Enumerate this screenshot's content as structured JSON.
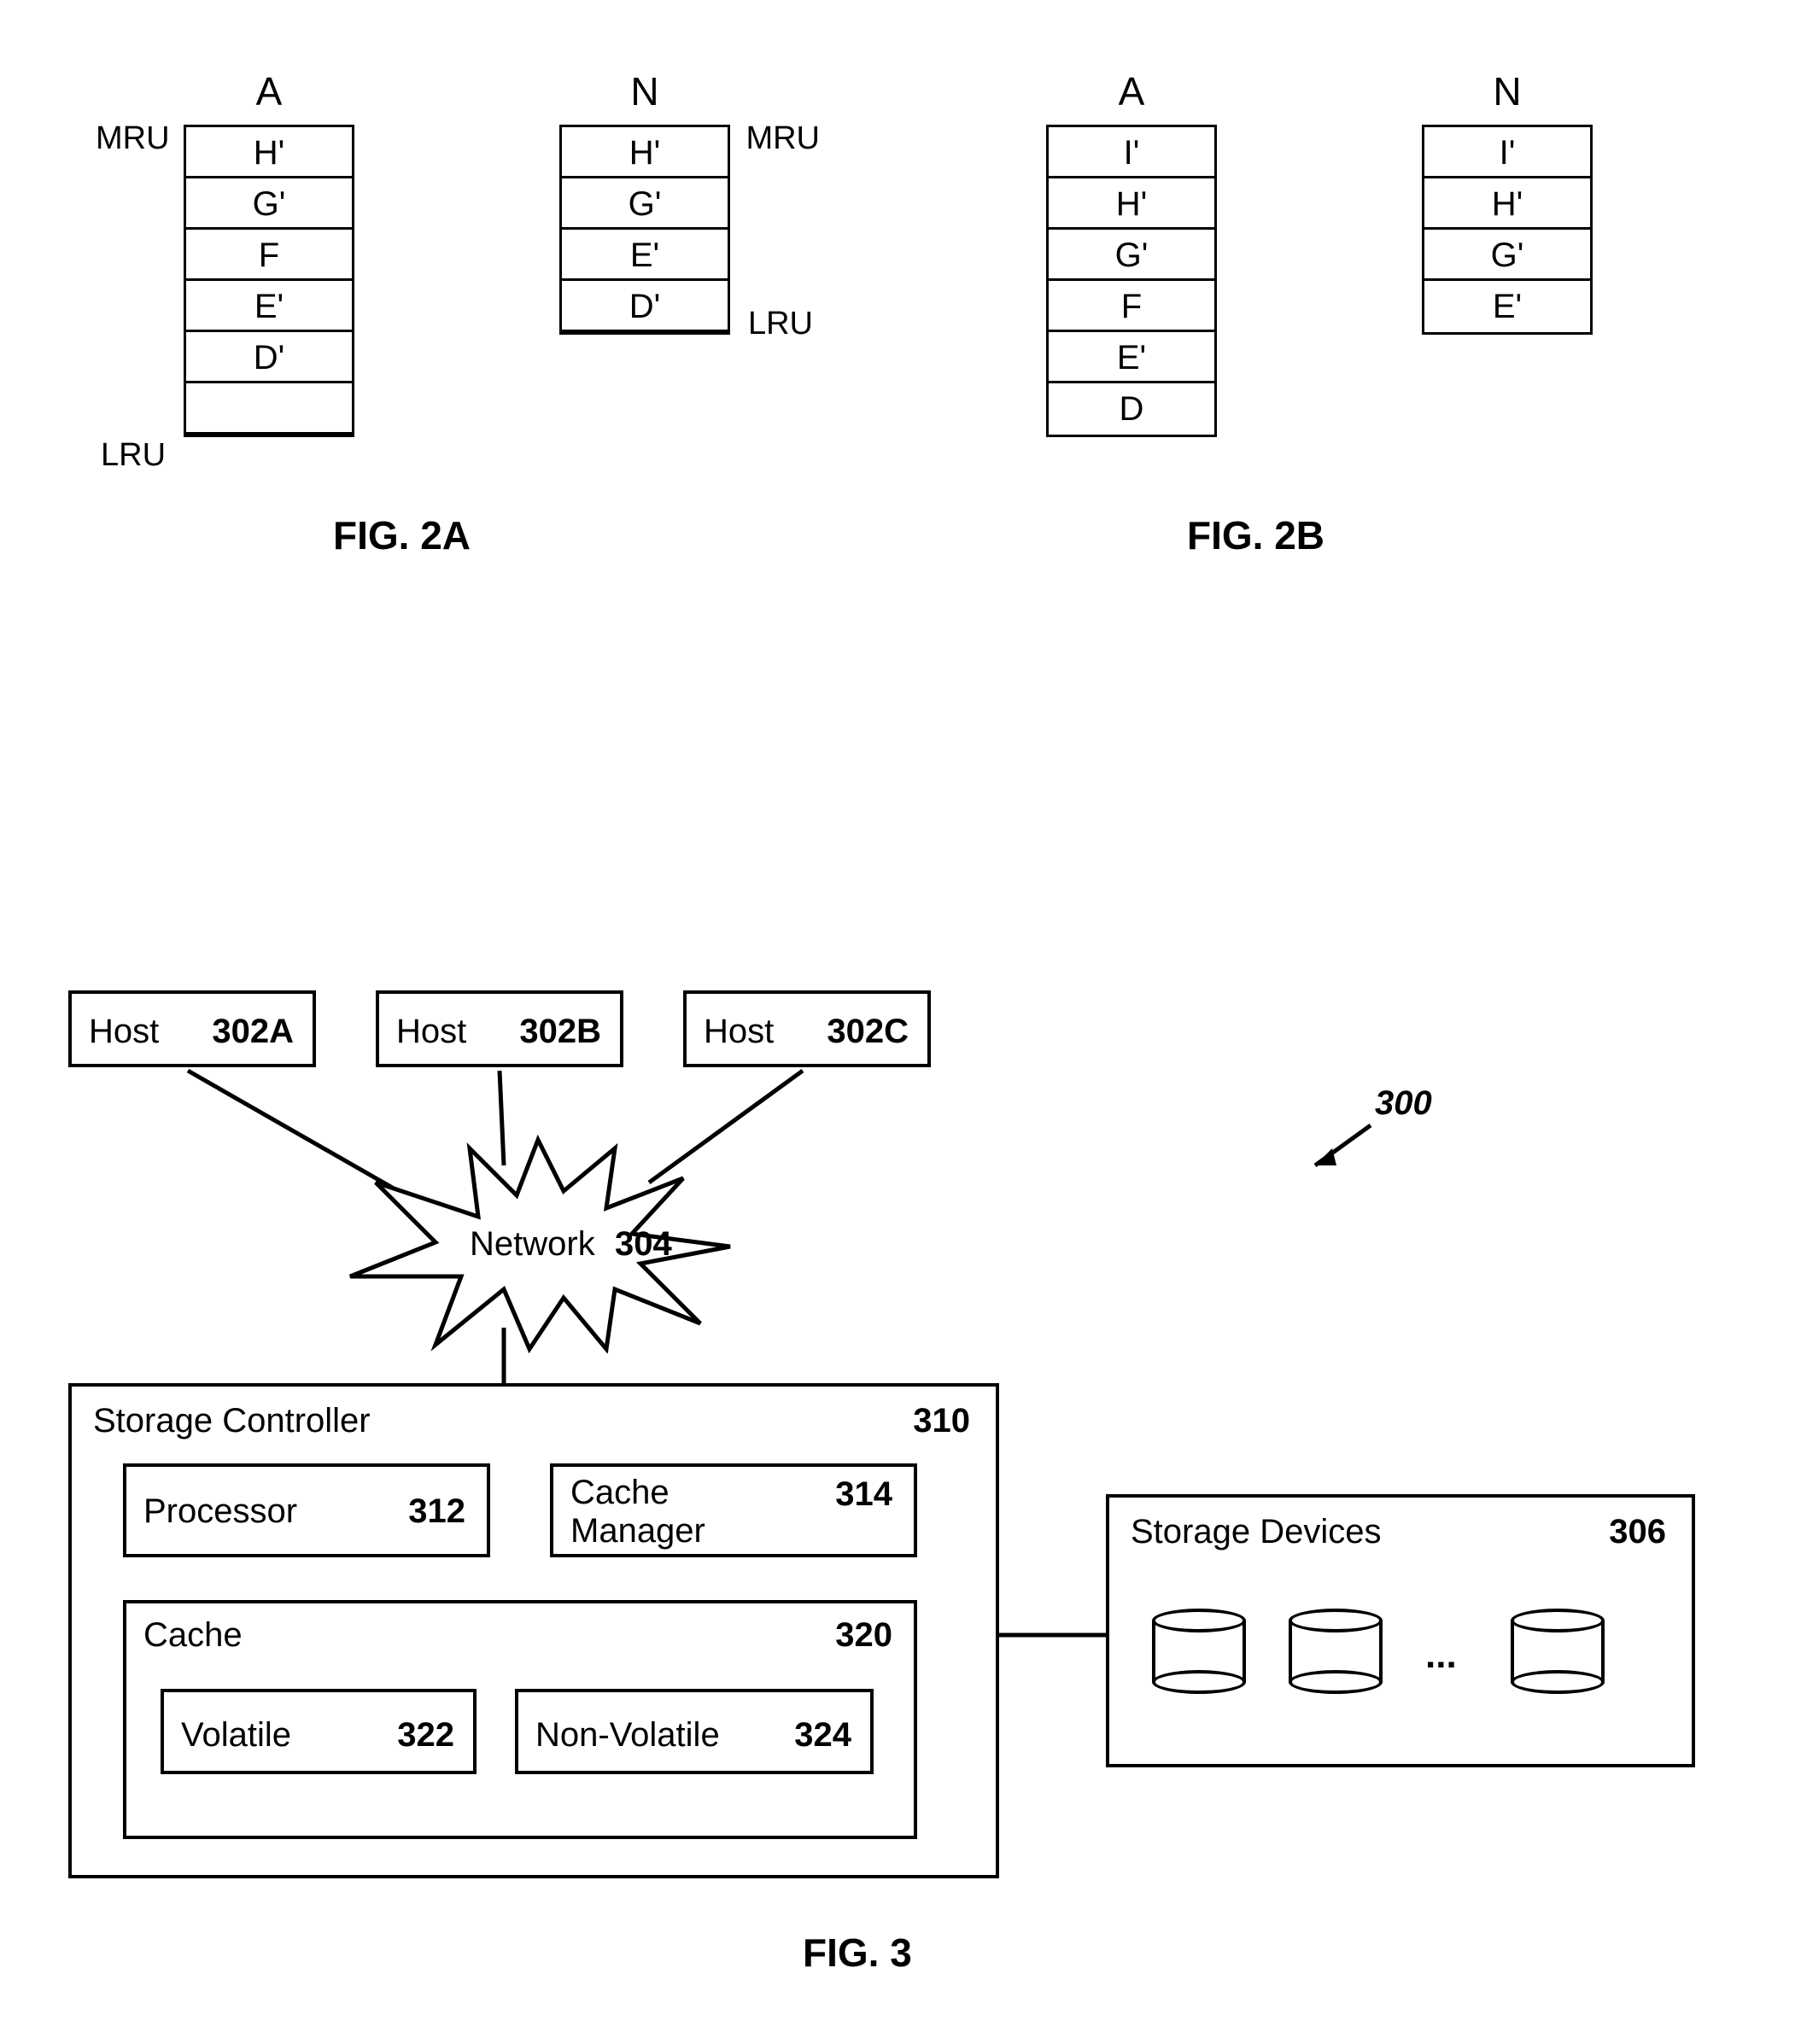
{
  "fig2a": {
    "caption": "FIG. 2A",
    "colA": {
      "title": "A",
      "cells": [
        "H'",
        "G'",
        "F",
        "E'",
        "D'",
        ""
      ],
      "mru": "MRU",
      "lru": "LRU"
    },
    "colN": {
      "title": "N",
      "cells": [
        "H'",
        "G'",
        "E'",
        "D'"
      ],
      "mru": "MRU",
      "lru": "LRU"
    }
  },
  "fig2b": {
    "caption": "FIG. 2B",
    "colA": {
      "title": "A",
      "cells": [
        "I'",
        "H'",
        "G'",
        "F",
        "E'",
        "D"
      ]
    },
    "colN": {
      "title": "N",
      "cells": [
        "I'",
        "H'",
        "G'",
        "E'"
      ]
    }
  },
  "fig3": {
    "caption": "FIG. 3",
    "system_ref": "300",
    "hosts": [
      {
        "label": "Host",
        "ref": "302A"
      },
      {
        "label": "Host",
        "ref": "302B"
      },
      {
        "label": "Host",
        "ref": "302C"
      }
    ],
    "network": {
      "label": "Network",
      "ref": "304"
    },
    "controller": {
      "label": "Storage Controller",
      "ref": "310",
      "processor": {
        "label": "Processor",
        "ref": "312"
      },
      "cache_manager": {
        "label": "Cache\nManager",
        "ref": "314"
      },
      "cache": {
        "label": "Cache",
        "ref": "320",
        "volatile": {
          "label": "Volatile",
          "ref": "322"
        },
        "nonvolatile": {
          "label": "Non-Volatile",
          "ref": "324"
        }
      }
    },
    "storage_devices": {
      "label": "Storage Devices",
      "ref": "306",
      "ellipsis": "..."
    }
  }
}
